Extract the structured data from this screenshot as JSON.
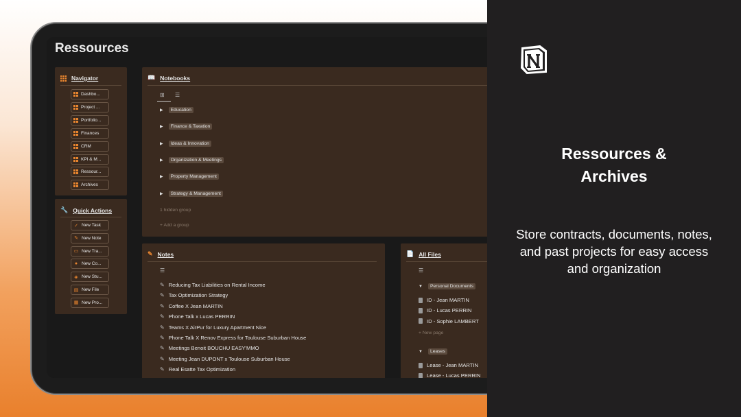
{
  "page": {
    "title": "Ressources"
  },
  "navigator": {
    "title": "Navigator",
    "items": [
      "Dashbo...",
      "Project ...",
      "Portfolio...",
      "Finances",
      "CRM",
      "KPI & M...",
      "Ressour...",
      "Archives"
    ]
  },
  "quick_actions": {
    "title": "Quick Actions",
    "items": [
      {
        "label": "New Task",
        "icon": "check-icon"
      },
      {
        "label": "New Note",
        "icon": "pen-icon"
      },
      {
        "label": "New Tra...",
        "icon": "money-icon"
      },
      {
        "label": "New Co...",
        "icon": "person-icon"
      },
      {
        "label": "New Stu...",
        "icon": "layers-icon"
      },
      {
        "label": "New File",
        "icon": "file-icon"
      },
      {
        "label": "New Pro...",
        "icon": "grid-icon"
      }
    ]
  },
  "notebooks": {
    "title": "Notebooks",
    "groups": [
      "Education",
      "Finance & Taxation",
      "Ideas & Innovation",
      "Organization & Meetings",
      "Property Management",
      "Strategy & Management"
    ],
    "hidden_label": "1 hidden group",
    "add_label": "+ Add a group"
  },
  "notes": {
    "title": "Notes",
    "items": [
      "Reducing Tax Liabilities on Rental Income",
      "Tax Optimization Strategy",
      "Coffee X Jean MARTIN",
      "Phone Talk x Lucas PERRIN",
      "Teams X AirPur for Luxury Apartment Nice",
      "Phone Talk X Renov Express for Toulouse Suburban House",
      "Meetings Benoit BOUCHU EASY'MMO",
      "Meeting Jean DUPONT x Toulouse Suburban House",
      "Real Esatte Tax Optimization"
    ]
  },
  "all_files": {
    "title": "All Files",
    "group1": "Personal Documents",
    "group1_items": [
      "ID - Jean MARTIN",
      "ID - Lucas PERRIN",
      "ID - Sophie LAMBERT"
    ],
    "new_page": "+ New page",
    "group2": "Leases",
    "group2_items": [
      "Lease - Jean MARTIN",
      "Lease - Lucas PERRIN"
    ]
  },
  "promo": {
    "title_line1": "Ressources &",
    "title_line2": "Archives",
    "desc_line1": "Store contracts, documents, notes,",
    "desc_line2": "and past projects for easy access",
    "desc_line3": "and organization"
  },
  "colors": {
    "accent": "#e8852f",
    "panel": "#3a2a1f",
    "screen": "#191919",
    "sidebar_bg": "#211f20"
  }
}
